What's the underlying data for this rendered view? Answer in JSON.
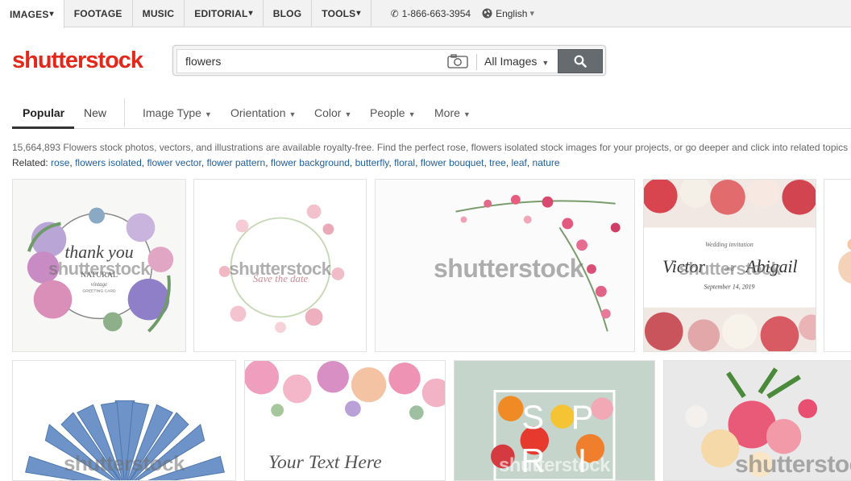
{
  "topnav": {
    "items": [
      {
        "label": "IMAGES",
        "caret": "▾"
      },
      {
        "label": "FOOTAGE",
        "caret": ""
      },
      {
        "label": "MUSIC",
        "caret": ""
      },
      {
        "label": "EDITORIAL",
        "caret": "▾"
      },
      {
        "label": "BLOG",
        "caret": ""
      },
      {
        "label": "TOOLS",
        "caret": "▾"
      }
    ],
    "phone": "1-866-663-3954",
    "language": "English"
  },
  "logo": {
    "text": "shutterstock",
    "color": "#e2281b"
  },
  "search": {
    "value": "flowers",
    "type_label": "All Images"
  },
  "filters": {
    "tabs": [
      "Popular",
      "New"
    ],
    "dropdowns": [
      "Image Type",
      "Orientation",
      "Color",
      "People",
      "More"
    ]
  },
  "results": {
    "summary": "15,664,893 Flowers stock photos, vectors, and illustrations are available royalty-free. Find the perfect rose, flowers isolated stock images for your projects, or go deeper and click into related topics",
    "related_label": "Related:",
    "related": [
      "rose",
      "flowers isolated",
      "flower vector",
      "flower pattern",
      "flower background",
      "butterfly",
      "floral",
      "flower bouquet",
      "tree",
      "leaf",
      "nature"
    ]
  },
  "images": {
    "watermark": "shutterstock",
    "card1": {
      "line1": "thank you",
      "line2": "NATURAL",
      "line3": "vintage",
      "line4": "GREETING CARD"
    },
    "card2": {
      "text": "Save the date"
    },
    "card4": {
      "label": "Wedding invitation",
      "name1": "Victor",
      "amp": "and",
      "name2": "Abigail",
      "date": "September 14, 2019"
    },
    "card6": {
      "text": "Your Text Here"
    },
    "card7": {
      "letters": [
        "S",
        "P",
        "R",
        "I"
      ]
    }
  },
  "colors": {
    "accent": "#e2281b",
    "link": "#1d5e9c",
    "search_button": "#666b6f"
  }
}
